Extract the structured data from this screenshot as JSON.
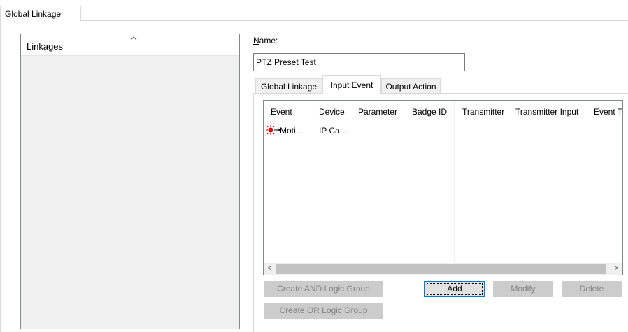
{
  "outer_tab": {
    "label": "Global Linkage"
  },
  "linkages": {
    "header": "Linkages"
  },
  "name": {
    "label_first": "N",
    "label_rest": "ame:",
    "value": "PTZ Preset Test"
  },
  "inner_tabs": [
    {
      "label": "Global Linkage"
    },
    {
      "label": "Input Event"
    },
    {
      "label": "Output Action"
    }
  ],
  "table": {
    "columns": [
      "Event",
      "Device",
      "Parameter",
      "Badge ID",
      "Transmitter",
      "Transmitter Input",
      "Event T"
    ],
    "rows": [
      {
        "event": "Moti...",
        "device": "IP Ca...",
        "event_icon": "motion-detection-icon"
      }
    ]
  },
  "scrollbar": {
    "left_arrow": "<",
    "right_arrow": ">"
  },
  "buttons": {
    "create_and": "Create AND Logic Group",
    "create_or": "Create OR Logic Group",
    "add": "Add",
    "modify": "Modify",
    "delete": "Delete"
  },
  "colors": {
    "accent": "#0078d7",
    "disabled_bg": "#cccccc",
    "icon_red": "#e00000"
  }
}
